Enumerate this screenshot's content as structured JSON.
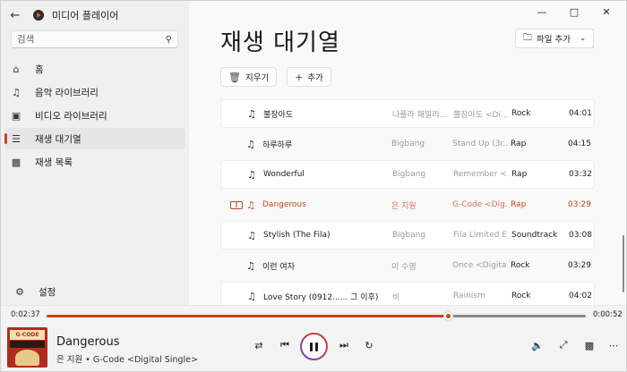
{
  "app": {
    "title": "미디어 플레이어"
  },
  "search": {
    "placeholder": "검색"
  },
  "nav": {
    "home": "홈",
    "music_library": "음악 라이브러리",
    "video_library": "비디오 라이브러리",
    "play_queue": "재생 대기열",
    "playlists": "재생 목록",
    "settings": "설정"
  },
  "main": {
    "title": "재생 대기열",
    "add_files": "파일 추가",
    "clear": "지우기",
    "add": "추가"
  },
  "queue": [
    {
      "title": "불장아도",
      "artist": "나플라 패밀리...",
      "album": "불장아도 <Di...",
      "genre": "Rock",
      "duration": "04:01"
    },
    {
      "title": "하루하루",
      "artist": "Bigbang",
      "album": "Stand Up (3r...",
      "genre": "Rap",
      "duration": "04:15"
    },
    {
      "title": "Wonderful",
      "artist": "Bigbang",
      "album": "Remember <...",
      "genre": "Rap",
      "duration": "03:32"
    },
    {
      "title": "Dangerous",
      "artist": "은 지원",
      "album": "G-Code <Dig...",
      "genre": "Rap",
      "duration": "03:29"
    },
    {
      "title": "Stylish (The Fila)",
      "artist": "Bigbang",
      "album": "Fila Limited E...",
      "genre": "Soundtrack",
      "duration": "03:08"
    },
    {
      "title": "이런 여자",
      "artist": "이 수영",
      "album": "Once <Digita...",
      "genre": "Rock",
      "duration": "03:29"
    },
    {
      "title": "Love Story (0912...... 그 이후)",
      "artist": "비",
      "album": "Rainism",
      "genre": "Rock",
      "duration": "04:02"
    }
  ],
  "playing_index": 3,
  "player": {
    "elapsed": "0:02:37",
    "remaining": "0:00:52",
    "progress": 0.745,
    "now_title": "Dangerous",
    "now_subtitle": "은 지원 • G-Code <Digital Single>"
  },
  "colors": {
    "accent": "#c4461d"
  }
}
